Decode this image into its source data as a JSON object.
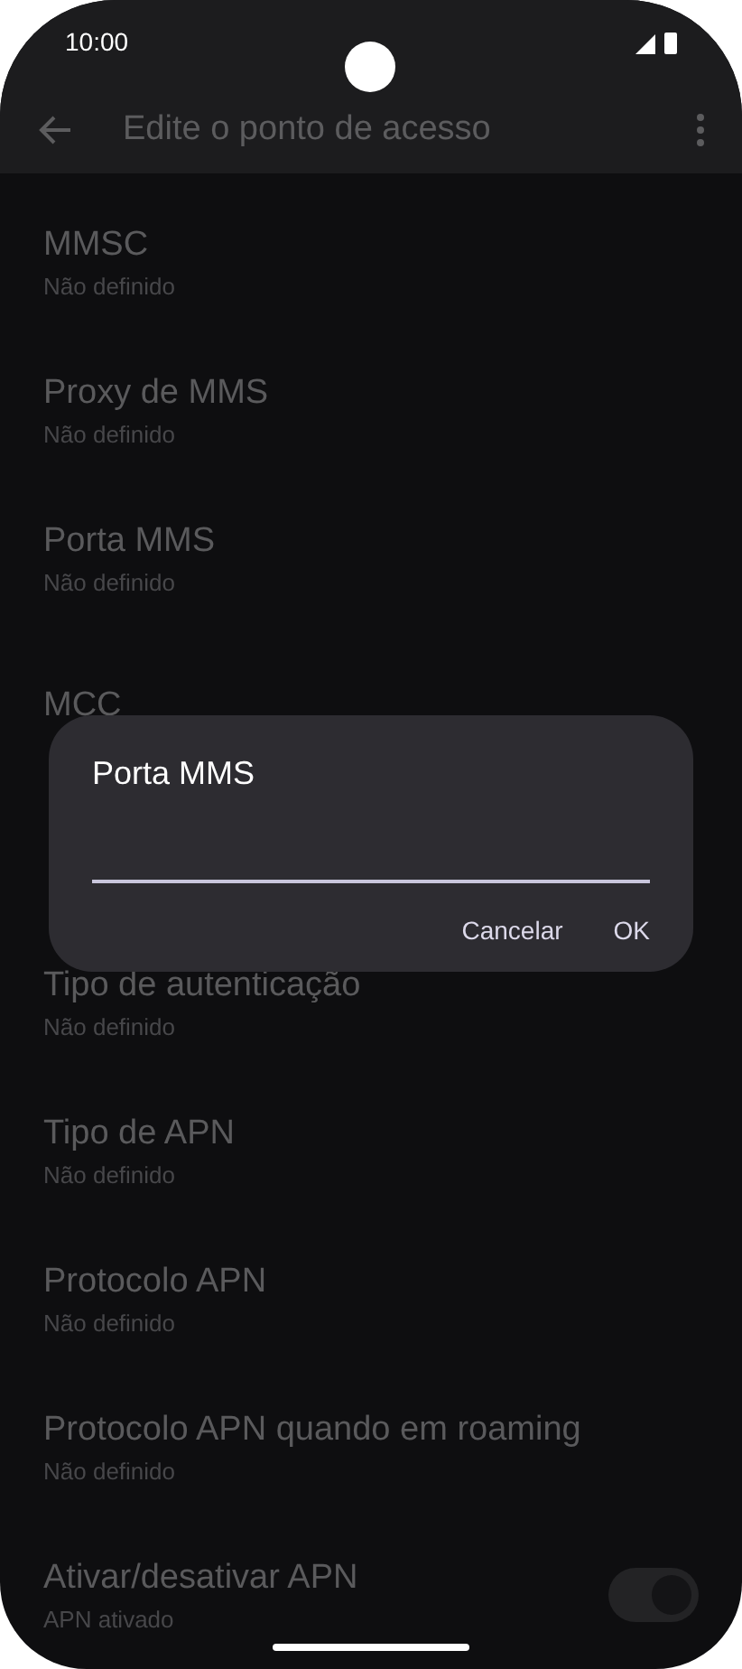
{
  "status_bar": {
    "time": "10:00"
  },
  "app_bar": {
    "title": "Edite o ponto de acesso"
  },
  "items": [
    {
      "kind": "text",
      "title": "MMSC",
      "subtitle": "Não definido"
    },
    {
      "kind": "text",
      "title": "Proxy de MMS",
      "subtitle": "Não definido"
    },
    {
      "kind": "text",
      "title": "Porta MMS",
      "subtitle": "Não definido"
    },
    {
      "kind": "text",
      "title": "MCC"
    },
    {
      "kind": "hidden"
    },
    {
      "kind": "text",
      "title": "Tipo de autenticação",
      "subtitle": "Não definido"
    },
    {
      "kind": "text",
      "title": "Tipo de APN",
      "subtitle": "Não definido"
    },
    {
      "kind": "text",
      "title": "Protocolo APN",
      "subtitle": "Não definido"
    },
    {
      "kind": "text",
      "title": "Protocolo APN quando em roaming",
      "subtitle": "Não definido"
    },
    {
      "kind": "switch",
      "title": "Ativar/desativar APN",
      "subtitle": "APN ativado",
      "on": true
    }
  ],
  "dialog": {
    "title": "Porta MMS",
    "buttons": [
      "Cancelar",
      "OK"
    ]
  }
}
